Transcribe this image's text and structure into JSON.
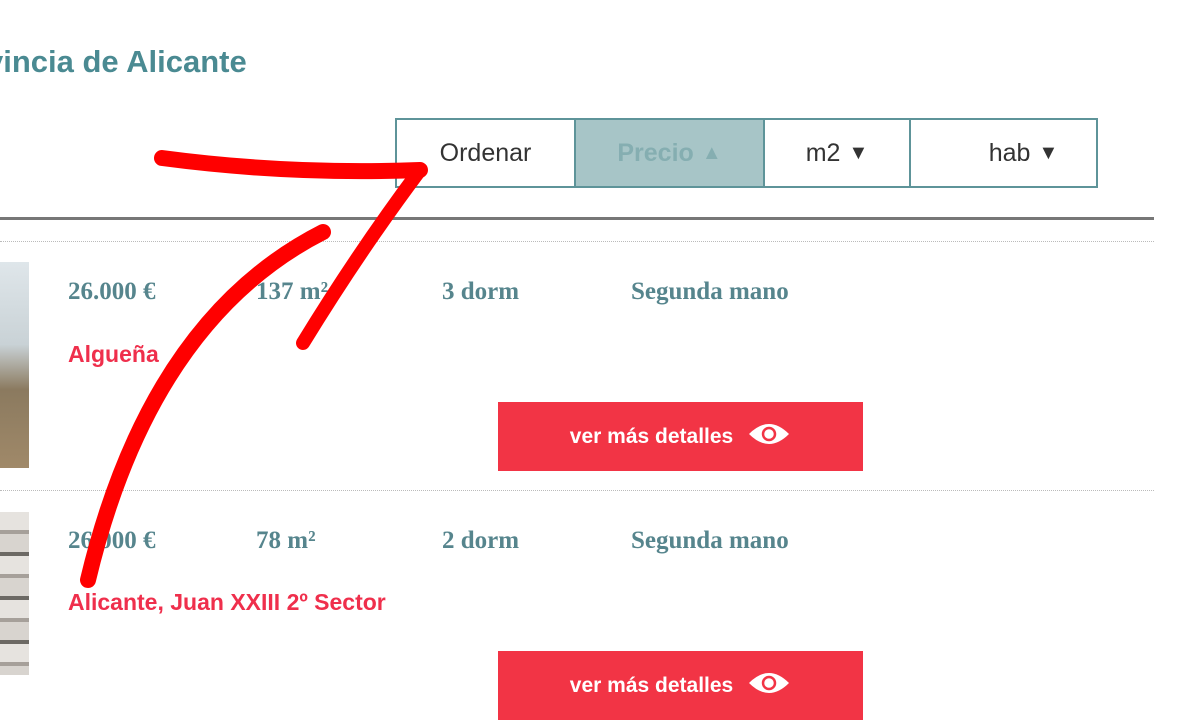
{
  "header": {
    "title": "vincia de Alicante"
  },
  "sort": {
    "label": "Ordenar",
    "options": [
      {
        "label": "Precio",
        "arrow": "▲",
        "active": true
      },
      {
        "label": "m2",
        "arrow": "▼",
        "active": false
      },
      {
        "label": "hab",
        "arrow": "▼",
        "active": false
      }
    ]
  },
  "listings": [
    {
      "price": "26.000 €",
      "area": "137 m²",
      "rooms": "3 dorm",
      "condition": "Segunda mano",
      "location": "Algueña",
      "button": "ver más detalles"
    },
    {
      "price": "26.000 €",
      "area": "78 m²",
      "rooms": "2 dorm",
      "condition": "Segunda mano",
      "location": "Alicante, Juan XXIII 2º Sector",
      "button": "ver más detalles"
    }
  ],
  "icons": {
    "eye": "eye-icon",
    "annotation": "red-hand-drawn-arrow"
  },
  "colors": {
    "accent": "#f23445",
    "teal": "#4a8a92",
    "active_sort": "#a7c5c7",
    "annotation": "#ff0000"
  }
}
